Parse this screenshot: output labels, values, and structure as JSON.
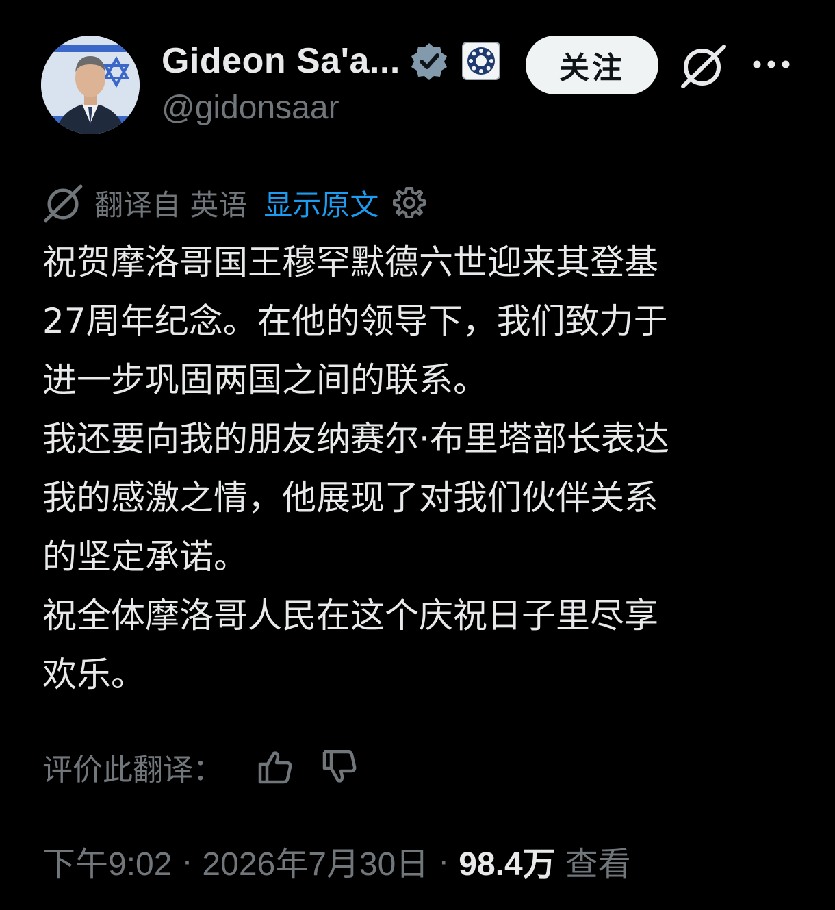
{
  "author": {
    "display_name": "Gideon Sa'a...",
    "handle": "@gidonsaar",
    "avatar": "avatar-photo",
    "verified_badge": "verified-badge-icon",
    "affiliation_badge": "government-affiliation-icon"
  },
  "header": {
    "follow_label": "关注",
    "grok_icon": "grok-icon",
    "more_icon": "more-dots-icon"
  },
  "translation": {
    "translated_from": "翻译自 英语",
    "show_original": "显示原文",
    "settings_icon": "gear-icon"
  },
  "tweet": {
    "lines": [
      "祝贺摩洛哥国王穆罕默德六世迎来其登基",
      "27周年纪念。在他的领导下，我们致力于",
      "进一步巩固两国之间的联系。",
      "我还要向我的朋友纳赛尔·布里塔部长表达",
      "我的感激之情，他展现了对我们伙伴关系",
      "的坚定承诺。",
      "祝全体摩洛哥人民在这个庆祝日子里尽享",
      "欢乐。"
    ]
  },
  "rate": {
    "label": "评价此翻译：",
    "thumb_up_icon": "thumbs-up-icon",
    "thumb_down_icon": "thumbs-down-icon"
  },
  "meta": {
    "time": "下午9:02",
    "separator": "·",
    "date": "2026年7月30日",
    "views_count": "98.4万",
    "views_label": "查看"
  },
  "colors": {
    "background": "#000000",
    "text_primary": "#e7e9ea",
    "text_secondary": "#71767b",
    "link_blue": "#1d9bf0",
    "follow_bg": "#eff3f4"
  }
}
